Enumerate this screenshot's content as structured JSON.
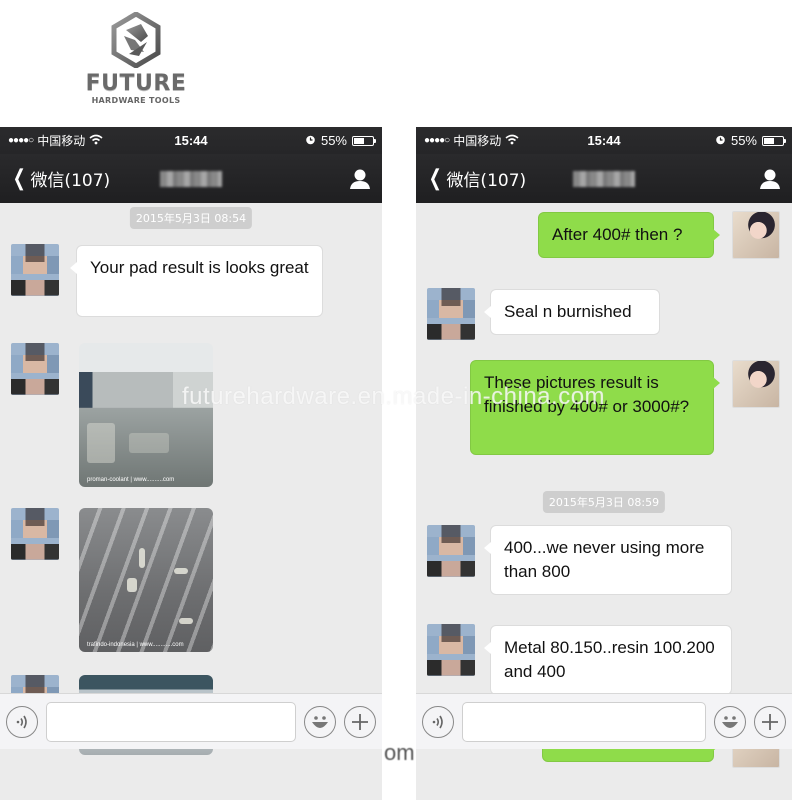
{
  "logo": {
    "name": "FUTURE",
    "subtitle": "HARDWARE TOOLS",
    "icon": "hexagon-logo-icon"
  },
  "watermark": {
    "text": "futurehardware.en.made-in-china.com",
    "fragment": "om"
  },
  "statusbar": {
    "signal": "●●●●○",
    "carrier": "中国移动",
    "wifi_icon": "wifi-icon",
    "time": "15:44",
    "alarm_icon": "alarm-clock-icon",
    "battery": "55%",
    "battery_level": 0.55
  },
  "navbar": {
    "back_label": "微信(107)",
    "back_icon": "chevron-left-icon",
    "title": "(blurred contact name)",
    "profile_icon": "person-icon"
  },
  "left_phone": {
    "timestamp": "2015年5月3日 08:54",
    "messages": [
      {
        "from": "contact",
        "type": "text",
        "text": "Your pad result is looks great"
      },
      {
        "from": "contact",
        "type": "image",
        "caption": "proman-coolant | www..........com",
        "description": "polished warehouse floor corridor"
      },
      {
        "from": "contact",
        "type": "image",
        "caption": "trafindo-indonesia | www............com",
        "description": "polished concrete floor with reflections"
      },
      {
        "from": "contact",
        "type": "image",
        "caption": "",
        "description": "large industrial hall with workers grinding floor"
      }
    ]
  },
  "right_phone": {
    "messages": [
      {
        "from": "me",
        "type": "text",
        "text": "After 400# then ?"
      },
      {
        "from": "contact",
        "type": "text",
        "text": "Seal n burnished"
      },
      {
        "from": "me",
        "type": "text",
        "text": "These pictures result is finished by 400# or 3000#?"
      },
      {
        "from": "contact",
        "type": "text",
        "text": "400...we never using more than 800"
      },
      {
        "from": "contact",
        "type": "text",
        "text": "Metal 80.150..resin 100.200 and 400"
      },
      {
        "from": "me",
        "type": "text",
        "text": ""
      }
    ],
    "timestamp": "2015年5月3日 08:59"
  },
  "inputbar": {
    "voice_icon": "voice-icon",
    "emoji_icon": "smiley-icon",
    "plus_icon": "plus-icon",
    "input_value": ""
  },
  "colors": {
    "outgoing_bubble": "#8fdc4a",
    "incoming_bubble": "#ffffff",
    "chat_bg": "#ebebeb",
    "nav_bg": "#222224"
  }
}
